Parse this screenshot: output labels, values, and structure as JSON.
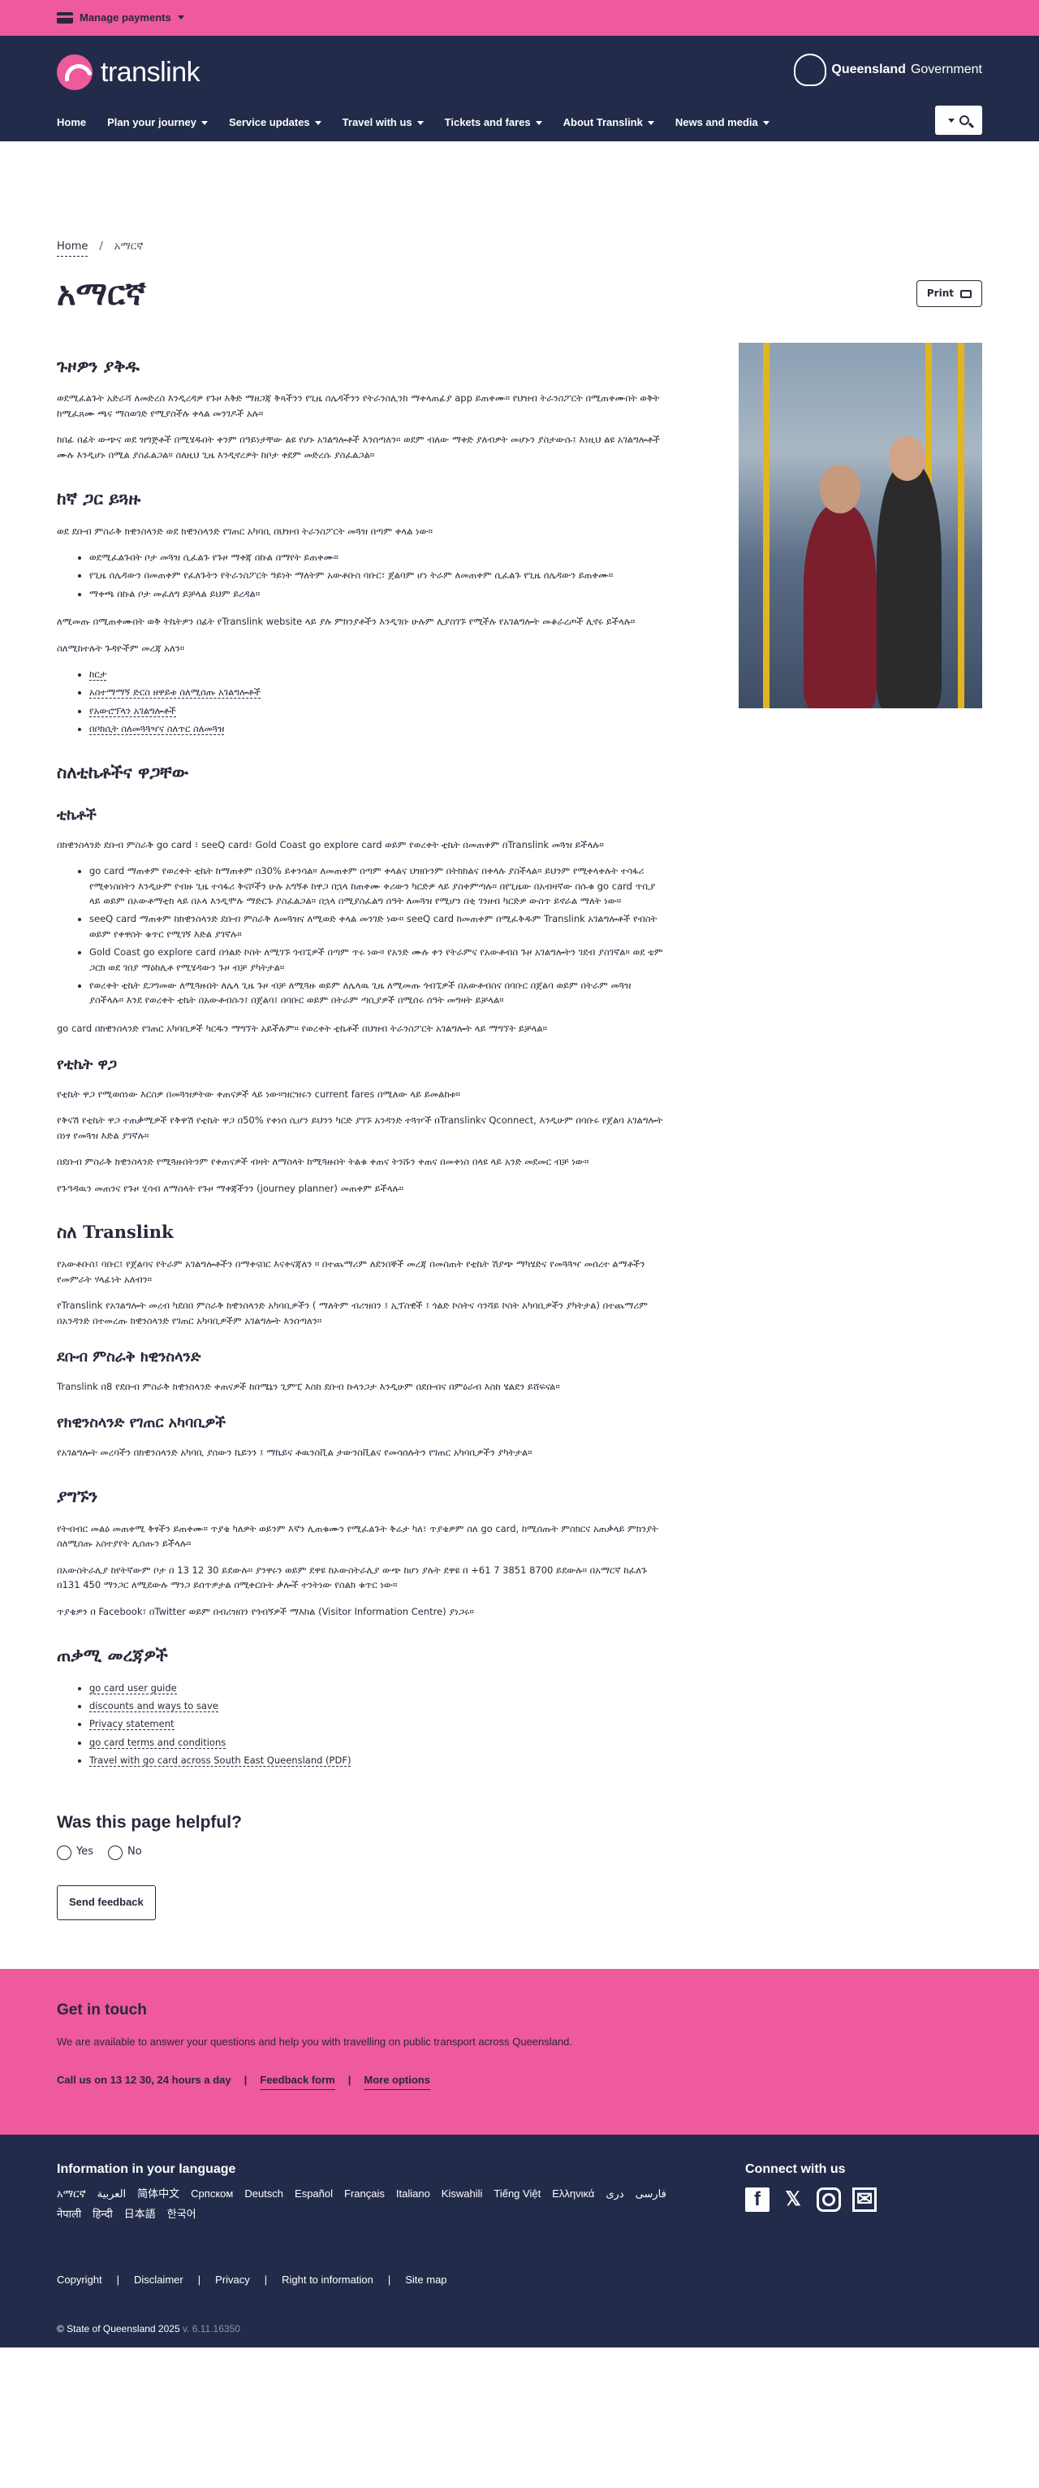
{
  "topbar": {
    "manage_label": "Manage payments"
  },
  "header": {
    "logo_text": "translink",
    "gov_bold": "Queensland",
    "gov_text": "Government",
    "nav": [
      "Home",
      "Plan your journey",
      "Service updates",
      "Travel with us",
      "Tickets and fares",
      "About Translink",
      "News and media"
    ]
  },
  "breadcrumb": {
    "home": "Home",
    "separator": "/",
    "current": "አማርኛ"
  },
  "page": {
    "title": "አማርኛ",
    "print_label": "Print"
  },
  "sections": {
    "s1": {
      "h": "ጉዞዎን ያቅዱ",
      "p1": "ወደሚፈልጉት አድራሻ ለመድረስ እንዲረዳዎ የጉዞ እቅድ ማዘጋጃ ቅጻችንን የጊዜ ሰሌዳችንን የትራንስሊንክ ማቀላጠፊያ app ይጠቀሙ። የህዝብ ትራንስፖርት በሚጠቀሙበት ወቅት ከሚፈጸሙ ጫና ማስወገድ የሚያስችሉ ቀላል መንገዶች አሉ።",
      "p2": "ከበፊ በፊት ውጭና ወደ ዝግጅቶች በሚሄዱበት ቀንም በዓይነታቸው ልዩ የሆኑ አገልግሎቶች እንሰጣለን። ወደም ብለው ማቀድ ያለብዎት መሆኑን ያስታውሱ፤ እነዚህ ልዩ አገልግሎቶች ሙሉ እንዲሆኑ በሚል ያስፈልጋል። ስለዚህ ጊዜ እንዲኖረዎት ከቦታ ቀደም መድረሱ ያስፈልጋል።"
    },
    "s2": {
      "h": "ከኛ ጋር ይጓዙ",
      "p1": "ወደ ደቡብ ምስራቅ ክዊንስላንድ ወደ ክዊንስላንድ የገጠር አካባቢ በህዝብ ትራንስፖርት መጓዝ በጣም ቀላል ነው።",
      "li": [
        "ወደሚፈልጉበት ቦታ መጓዝ ሲፈልጉ የጉዞ ማቀጃ በኩል በማየት ይጠቀሙ።",
        "የጊዜ ሰሌዳውን በመጠቀም የፈለጉትን የትራንስፖርት ዓይነት ማለትም አውቶቡስ ባቡር፣ ጀልባም ሆነ ትራም ለመጠቀም ሲፈልጉ የጊዜ ሰሌዳውን ይጠቀሙ።",
        "ማቀጫ በኩል ቦታ መፈለግ ይቻላል ይህም ይረዳል።"
      ],
      "p2": "ለሚመጡ በሚጠቀሙበት ወቅ ትኬትዎን በፊት የTranslink website ላይ ያሉ ምክንያቶችን እንዲገቡ ሁሉም ሊያስገኙ የሚችሉ የአገልግሎት መቆራረጦች ሊኖሩ ይችላሉ።",
      "p3": "ስለሚከተሉት ጉዳዮችም መረጃ አለን።",
      "li2": [
        "ከርታ",
        "አስተማማኝ ድርስ ዘዋይቱ ስለሚሰጡ አገልግሎቶች",
        "የአውሮፕላን አገልግሎቶች",
        "በቦክሲት ስለመጓጓዣና ስለጥር ስለመጓዝ"
      ]
    },
    "s3": {
      "h": "ስለቲኬቶችና ዋጋቸው",
      "sub": "ቲኬቶች",
      "p1": "በክዊንስላንድ ደቡብ ምስራቅ go card ፣ seeQ card፣ Gold Coast go explore card ወይም የወረቀት ቲኬት በመጠቀም በTranslink መጓዝ ይችላሉ።",
      "li": [
        "go card ማጠቀም የወረቀት ቲኬት ከማጠቀም በ30% ይቀንሳል። ለመጠቀም በጣም ቀላልና ህዝቡንም በትክክልና በቀላሉ ያስችላል። ይህንም የሚቀላቀሉት ተሳፋሪ የሚቀነስበትን እንዲሁም የብዙ ጊዜ ተሳፋሪ ቅናሾችን ሁሉ አግኝቶ ከዋጋ በኋላ ከጠቀሙ ቀሪውን ካርድዎ ላይ ያስቀምጣሉ። በየጊዜው በአብዛኛው በሱቁ go card ጥቢያ ላይ ወይም በኦውቶማቲክ ላይ በኦላ እንዲሞሉ ማድርጉ ያስፈልጋል። በኋላ በሚያስፈልግ ሰዓት ለመጓዝ የሚሆን በቂ ገንዘብ ካርድዎ ውስጥ ይኖራል ማለት ነው።",
        "seeQ card ማጠቀም ከክዊንስላንድ ደቡብ ምስራቅ ለመጓዝና ለሚወድ ቀላል መንገድ ነው። seeQ card ከመጠቀም በሚፈቅዱም Translink አገልግሎቶች የብስት ወይም የቀዋስት ቁጥር የሚገኝ እድል ያገኛሉ።",
        "Gold Coast go explore card በጎልድ ኮስት ለሚገኙ ጎብኚዎች በጣም ጥሩ ነው። የአንድ ሙሉ ቀን የትራምና የአውቶብስ ጉዞ አገልግሎትን ገደብ ያስገኛል። ወደ ቴም ጋርክ ወደ ገበያ ማዕከሊቶ የሚሄዳውን ጉዞ ብቻ ያካትታል።",
        "የወረቀት ቲኬት ደጋግመው ለሚጓዙበት ለሌላ ጊዜ ጉዞ ብቻ ለሚጓዙ ወይም ለሌላዉ ጊዜ ለሚመጡ ጎብኚዎች በአውቶብስና በባቡር በጀልባ ወይም በትራም መጓዝ ያስችላሉ። እንደ የወረቀት ቲኬት በአውቶብሱን፤ በጀልባ፤ በባቡር ወይም በትራም ጣቢያዎች በሚሰሩ ሰዓት መግዛት ይቻላል።"
      ],
      "p2": "go card በክዊንስላንድ የገጠር አካባቢዎች ካርዱን ማግኘት አይችሉም። የወረቀት ቲኬቶች በህዝብ ትራንስፖርት አገልግሎት ላይ ማግኘት ይቻላል።"
    },
    "s4": {
      "h": "የቲኬት ዋጋ",
      "p1": "የቲኬት ዋጋ የሚወሰነው እርስዎ በመጓዝዎትው ቀጠናዎች ላይ ነው።ዝርዝሩን current fares በሚለው ላይ ይመልከቱ።",
      "p2": "የቅናሽ የቲኬት ዋጋ ተጠቃሚዎች የቅዋሽ የቲኬት ዋጋ በ50% የቀነሰ ሲሆን ይህንን ካርድ ያገኙ አንዳንድ ተጓዦች በTranslinkና Qconnect, እንዲሁም በባቡሩ የጀልባ አገልግሎት በነፃ የመጓዝ እድል ያገኛሉ።",
      "p3": "በደቡብ ምስራቅ ክዊንስላንድ የሚጓዙበትንም የቀጠናዎች ብዛት ለማስላት ከሚጓዙበት ትልቁ ቀጠና ትንሹን ቀጠና በመቀነስ በላዩ ላይ አንድ መደመር ብቻ ነው።",
      "p4": "የጉዓዳዉን መጠንና የጉዞ ሂሳብ ለማስላት የጉዞ ማቀጃችንን (journey planner) መጠቀም ይችላሉ።"
    },
    "s5": {
      "h": "ስለ Translink",
      "p1": "የአውቶቡስ፤ ባቡር፤ የጀልባና የትራም አገልግሎቶችን በማቀናበር እናቀናጃለን ። በተጨማሪም ለደንበኞች መረጃ በመስጠት የቲኬት ሽያጭ ማካሄድና የመጓጓዣ መሰረተ ልማቶችን የመምራት ሃላፊነት አለብን።",
      "p2": "የTranslink የአገልግሎት መረብ ካደበበ ምስራቅ ክዊንስላንድ አካባቢዎችን ( ማለትም ብሪዝበን ፤ ኢፕስዊች ፤ ጎልድ ኮስትና ሳንሻይ ኮስት አካባቢዎችን ያካትታል) በተጨማሪም በአንዳንድ በተመረጡ ክዊንስላንድ የገጠር አካባቢዎችም አገልግሎት እንሰጣለን።"
    },
    "s6": {
      "h": "ደቡብ ምስራቅ ክዊንስላንድ",
      "p1": "Translink በ8 የደቡብ ምስራቅ ክዊንስላንድ ቀጠናዎች ከበሜኔን ጊምፒ እስከ ደቡብ ኩላንጋታ እንዲሁም በደቡብና በምዕራብ እስከ ሄልደን ይሸፍናል።"
    },
    "s7": {
      "h": "የክዊንስላንድ የገጠር አካባቢዎች",
      "p1": "የአገልግሎት መረባችን በክዊንስላንድ አካባቢ ያሰውን ኬይንን ፤ ማኬይና ቶዉንስቪል ታውንስቪልና የመሳሰሉትን የገጠር አካባቢዎችን ያካትታል።"
    },
    "s8": {
      "h": "ያግኙን",
      "p1": "የትብብር መልዕ መጠቀሚ ቅፃችን ይጠቀሙ። ጥያቄ ካለዎት ወይንም እኛን ሊጠቁሙን የሚፈልጉት ቅሬታ ካለ፣ ጥያቄዎም ስለ go card, ከሚሰጡት ምስክርና አጠቃላይ ምክንያት ስለሚሰጡ አስተያየት ሊሰጡን ይችላሉ።",
      "p2": "በአውስትራሊያ ከየትኛውም ቦታ በ 13 12 30 ይደውሉ። ያንዋሩን ወይም ደዋዩ ከኦውስትራሊያ ውጭ ከሆነ ያሉት ደዋዩ በ +61 7 3851 8700 ይደውሉ። በአማርኛ ከፈለጉ በ131 450 ማንጋር ለሚደውሉ ማንጋ ይሰጥዎታል በሚቀርቡት ቃሎች ተንትነው የስልክ ቁጥር ነው።",
      "p3": "ጥያቄዎን በ Facebook፣ በTwitter ወይም በብሪዝበን የጎብኝዎች ማእከል (Visitor Information Centre) ያነጋሩ።"
    },
    "s9": {
      "h": "ጠቃሚ መረጃዎች",
      "links": [
        "go card user guide",
        "discounts and ways to save",
        "Privacy statement",
        "go card terms and conditions",
        "Travel with go card across South East Queensland (PDF)"
      ]
    }
  },
  "helpful": {
    "title": "Was this page helpful?",
    "yes": "Yes",
    "no": "No",
    "send": "Send feedback"
  },
  "touch": {
    "title": "Get in touch",
    "text": "We are available to answer your questions and help you with travelling on public transport across Queensland.",
    "call": "Call us on 13 12 30, 24 hours a day",
    "feedback": "Feedback form",
    "more": "More options",
    "sep": "|"
  },
  "footer": {
    "lang_title": "Information in your language",
    "langs": [
      "አማርኛ",
      "العربية",
      "简体中文",
      "Српском",
      "Deutsch",
      "Español",
      "Français",
      "Italiano",
      "Kiswahili",
      "Tiếng Việt",
      "Ελληνικά",
      "دری",
      "فارسی",
      "नेपाली",
      "हिन्दी",
      "日本語",
      "한국어"
    ],
    "connect_title": "Connect with us",
    "links": [
      "Copyright",
      "Disclaimer",
      "Privacy",
      "Right to information",
      "Site map"
    ],
    "copy": "© State of Queensland 2025",
    "version": "v. 6.11.16350"
  }
}
